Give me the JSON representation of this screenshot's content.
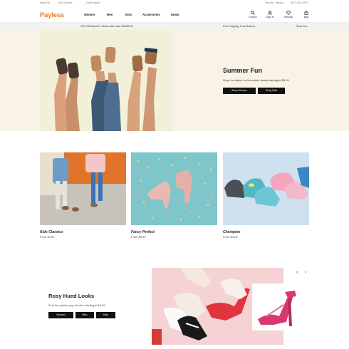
{
  "util_bar": {
    "left_link_1": "Easy Sel",
    "left_link_2": "Find a Store",
    "left_link_3": "Order Status",
    "account_link": "Returns · Books",
    "phone": "(877) 474-6379"
  },
  "header": {
    "logo": "Payless",
    "nav": [
      "Women",
      "Men",
      "Kids",
      "Accessories",
      "Deals"
    ],
    "icons": [
      {
        "name": "search-icon",
        "label": "Search"
      },
      {
        "name": "user-icon",
        "label": "Sign In"
      },
      {
        "name": "heart-icon",
        "label": "Wishlist"
      },
      {
        "name": "bag-icon",
        "label": "Bag"
      }
    ]
  },
  "promo": {
    "left": "15% Off Women's Shoes with code SANDFree",
    "middle": "Free Shipping, Free Returns",
    "right": "Shop ALL"
  },
  "hero": {
    "title": "Summer Fun",
    "subtitle": "Shop fun styles for the whole family starting at $9.99",
    "btn_1": "Shop Women",
    "btn_2": "Shop Kids"
  },
  "cards": [
    {
      "title": "Kids Classics",
      "price": "From $4.99"
    },
    {
      "title": "Fancy Perfect",
      "price": "From $9.99"
    },
    {
      "title": "Champion",
      "price": "From $4.29"
    }
  ],
  "rosy": {
    "title": "Rosy Hued Looks",
    "subtitle": "Find the perfect pop of color starting at $4.99",
    "btn_1": "Women",
    "btn_2": "Men",
    "btn_3": "Kids"
  },
  "carousel": {
    "prev": "‹",
    "next": "›"
  }
}
